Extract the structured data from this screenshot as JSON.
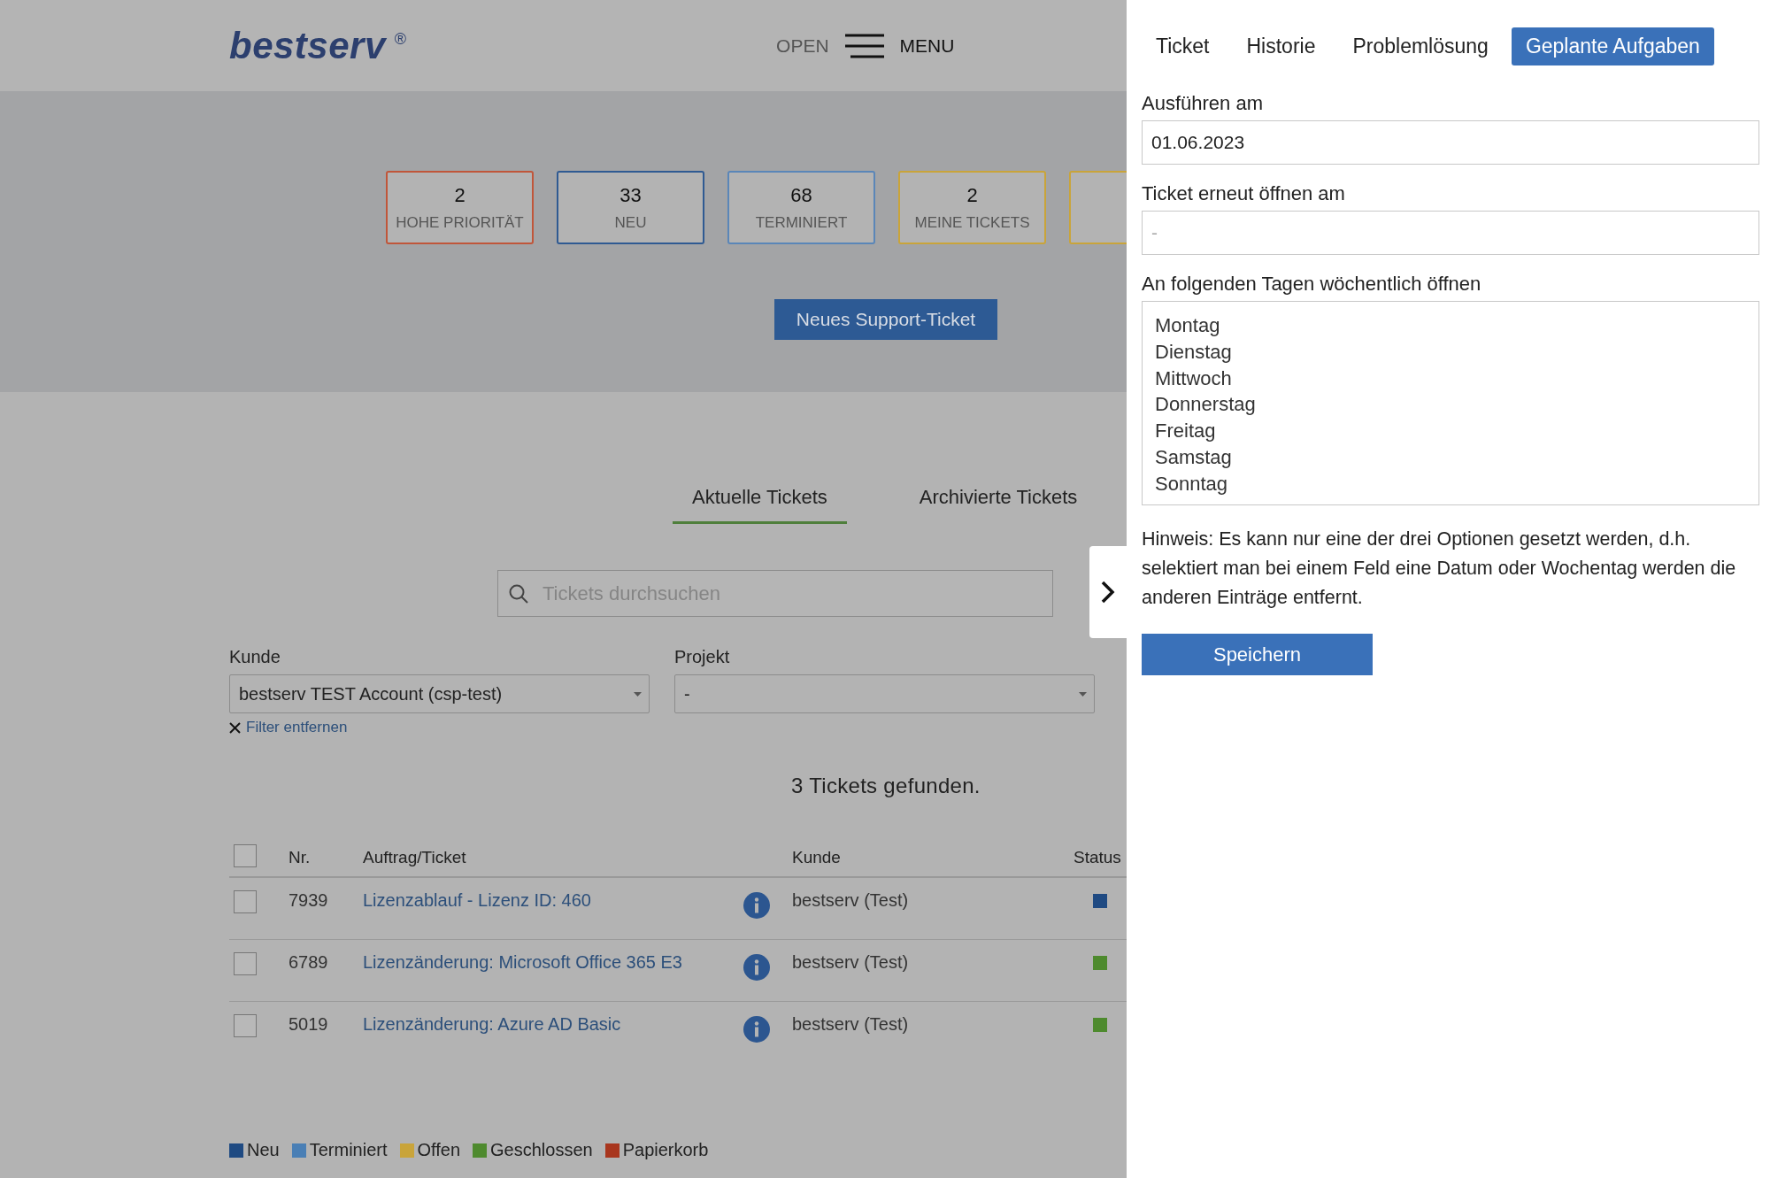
{
  "header": {
    "logo": "bestserv",
    "logo_mark": "®",
    "open_label": "OPEN",
    "menu_label": "MENU"
  },
  "stats": [
    {
      "count": "2",
      "label": "HOHE PRIORITÄT",
      "color": "#c0563a"
    },
    {
      "count": "33",
      "label": "NEU",
      "color": "#2f5a92"
    },
    {
      "count": "68",
      "label": "TERMINIERT",
      "color": "#5a86b8"
    },
    {
      "count": "2",
      "label": "MEINE TICKETS",
      "color": "#c9a43a"
    },
    {
      "color": "#c9a43a"
    }
  ],
  "new_ticket_button": "Neues Support-Ticket",
  "tabs": [
    {
      "label": "Aktuelle Tickets",
      "selected": true
    },
    {
      "label": "Archivierte Tickets",
      "selected": false
    }
  ],
  "search": {
    "placeholder": "Tickets durchsuchen"
  },
  "filters": [
    {
      "label": "Kunde",
      "value": "bestserv TEST Account (csp-test)",
      "clear_link": "Filter entfernen"
    },
    {
      "label": "Projekt",
      "value": "-"
    }
  ],
  "result_count": "3 Tickets gefunden.",
  "table": {
    "select_all_checked": false,
    "columns": [
      "Nr.",
      "Auftrag/Ticket",
      "Kunde",
      "Status"
    ],
    "rows": [
      {
        "checked": false,
        "nr": "7939",
        "title": "Lizenzablauf - Lizenz ID: 460",
        "customer": "bestserv (Test)",
        "color": "#1f4a82"
      },
      {
        "checked": false,
        "nr": "6789",
        "title": "Lizenzänderung: Microsoft Office 365 E3",
        "customer": "bestserv (Test)",
        "color": "#4e8a2e"
      },
      {
        "checked": false,
        "nr": "5019",
        "title": "Lizenzänderung: Azure AD Basic",
        "customer": "bestserv (Test)",
        "color": "#4e8a2e"
      }
    ]
  },
  "legend": [
    {
      "label": "Neu",
      "color": "#1f4a82"
    },
    {
      "label": "Terminiert",
      "color": "#4a7fb5"
    },
    {
      "label": "Offen",
      "color": "#c9a43a"
    },
    {
      "label": "Geschlossen",
      "color": "#4e8a2e"
    },
    {
      "label": "Papierkorb",
      "color": "#a8361e"
    }
  ],
  "panel": {
    "tabs": [
      {
        "label": "Ticket",
        "selected": false
      },
      {
        "label": "Historie",
        "selected": false
      },
      {
        "label": "Problemlösung",
        "selected": false
      },
      {
        "label": "Geplante Aufgaben",
        "selected": true
      }
    ],
    "fields": [
      {
        "label": "Ausführen am",
        "value": "01.06.2023"
      },
      {
        "label": "Ticket erneut öffnen am",
        "placeholder": "-"
      }
    ],
    "weekdays": {
      "label": "An folgenden Tagen wöchentlich öffnen",
      "options": [
        "Montag",
        "Dienstag",
        "Mittwoch",
        "Donnerstag",
        "Freitag",
        "Samstag",
        "Sonntag"
      ]
    },
    "hint": "Hinweis: Es kann nur eine der drei Optionen gesetzt werden, d.h. selektiert man bei einem Feld eine Datum oder Wochentag werden die anderen Einträge entfernt.",
    "save_button": "Speichern"
  }
}
